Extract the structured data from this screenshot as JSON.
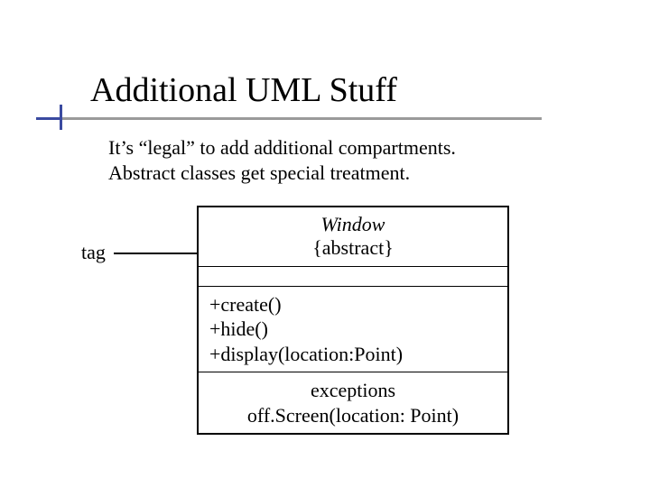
{
  "title": "Additional UML Stuff",
  "subtitle_line1": "It’s “legal” to add additional compartments.",
  "subtitle_line2": "Abstract classes get special treatment.",
  "tag_label": "tag",
  "uml": {
    "class_name": "Window",
    "constraint": "{abstract}",
    "operations": [
      "+create()",
      "+hide()",
      "+display(location:Point)"
    ],
    "extra_compartment_title": "exceptions",
    "extra_compartment_line": "off.Screen(location: Point)"
  }
}
